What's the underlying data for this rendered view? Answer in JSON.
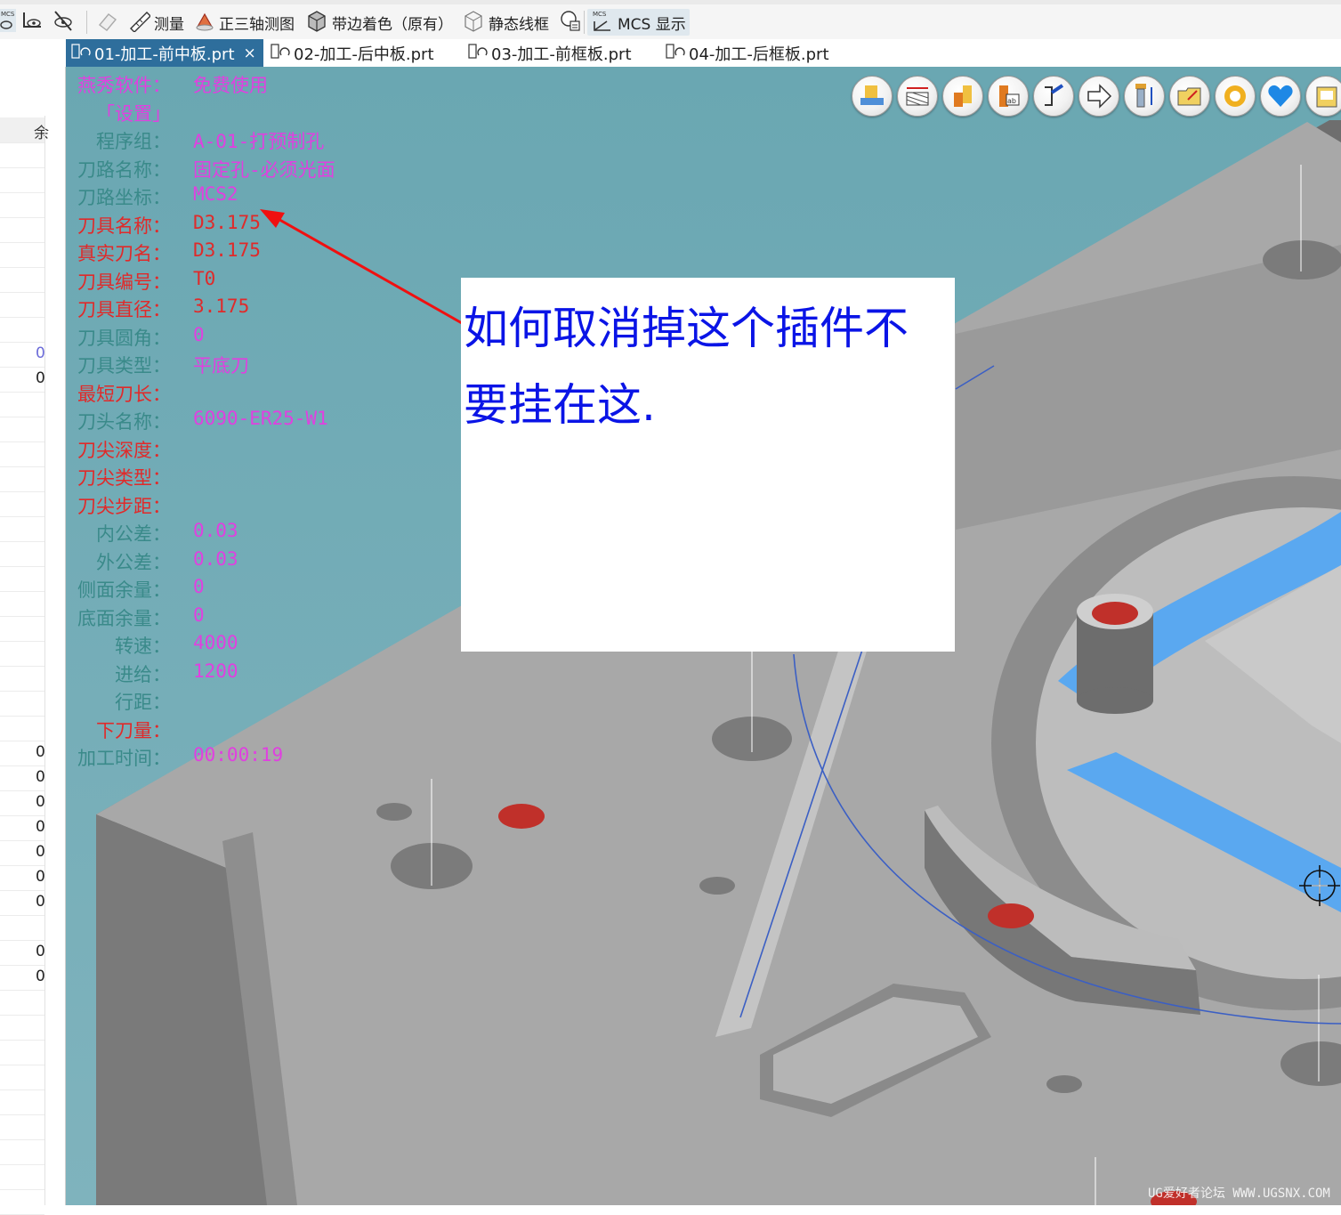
{
  "toolbar": {
    "items": [
      {
        "label": "",
        "icon": "mcs-view-icon"
      },
      {
        "label": "",
        "icon": "show-hide-icon"
      },
      {
        "label": "",
        "icon": "hide-all-icon"
      },
      {
        "label": "",
        "icon": "eraser-icon"
      },
      {
        "label": "测量",
        "icon": "ruler-icon"
      },
      {
        "label": "正三轴测图",
        "icon": "isometric-view-icon"
      },
      {
        "label": "带边着色（原有）",
        "icon": "shaded-edges-icon"
      },
      {
        "label": "静态线框",
        "icon": "wireframe-icon"
      },
      {
        "label": "",
        "icon": "layer-settings-icon"
      },
      {
        "label": "MCS 显示",
        "icon": "mcs-display-icon"
      }
    ]
  },
  "tabs": [
    {
      "label": "01-加工-前中板.prt",
      "active": true,
      "close": "×"
    },
    {
      "label": "02-加工-后中板.prt",
      "active": false
    },
    {
      "label": "03-加工-前框板.prt",
      "active": false
    },
    {
      "label": "04-加工-后框板.prt",
      "active": false
    }
  ],
  "left_panel": {
    "header": "余",
    "values": [
      "0",
      "0",
      "0",
      "0",
      "0",
      "0",
      "0",
      "0",
      "0",
      "0",
      "0"
    ]
  },
  "info_overlay": {
    "rows": [
      {
        "label": "燕秀软件：",
        "value": "免费使用",
        "label_color": "#e040e0",
        "value_color": "#e040e0"
      },
      {
        "label": "「设置」",
        "value": "",
        "label_color": "#e040e0",
        "value_color": "#e040e0"
      },
      {
        "label": "程序组：",
        "value": "A-01-打预制孔",
        "label_color": "#3a8a8a",
        "value_color": "#e040e0"
      },
      {
        "label": "刀路名称：",
        "value": "固定孔-必须光面",
        "label_color": "#3a8a8a",
        "value_color": "#e040e0"
      },
      {
        "label": "刀路坐标：",
        "value": "MCS2",
        "label_color": "#3a8a8a",
        "value_color": "#e040e0"
      },
      {
        "label": "刀具名称：",
        "value": "D3.175",
        "label_color": "#e02a2a",
        "value_color": "#e02a2a"
      },
      {
        "label": "真实刀名：",
        "value": "D3.175",
        "label_color": "#e02a2a",
        "value_color": "#e02a2a"
      },
      {
        "label": "刀具编号：",
        "value": "T0",
        "label_color": "#e02a2a",
        "value_color": "#e02a2a"
      },
      {
        "label": "刀具直径：",
        "value": "3.175",
        "label_color": "#e02a2a",
        "value_color": "#e02a2a"
      },
      {
        "label": "刀具圆角：",
        "value": "0",
        "label_color": "#3a8a8a",
        "value_color": "#e040e0"
      },
      {
        "label": "刀具类型：",
        "value": "平底刀",
        "label_color": "#3a8a8a",
        "value_color": "#e040e0"
      },
      {
        "label": "最短刀长：",
        "value": "",
        "label_color": "#e02a2a",
        "value_color": "#e02a2a"
      },
      {
        "label": "刀头名称：",
        "value": "6090-ER25-W1",
        "label_color": "#3a8a8a",
        "value_color": "#e040e0"
      },
      {
        "label": "刀尖深度：",
        "value": "",
        "label_color": "#e02a2a",
        "value_color": "#e02a2a"
      },
      {
        "label": "刀尖类型：",
        "value": "",
        "label_color": "#e02a2a",
        "value_color": "#e02a2a"
      },
      {
        "label": "刀尖步距：",
        "value": "",
        "label_color": "#e02a2a",
        "value_color": "#e02a2a"
      },
      {
        "label": "内公差：",
        "value": "0.03",
        "label_color": "#3a8a8a",
        "value_color": "#e040e0"
      },
      {
        "label": "外公差：",
        "value": "0.03",
        "label_color": "#3a8a8a",
        "value_color": "#e040e0"
      },
      {
        "label": "侧面余量：",
        "value": "0",
        "label_color": "#3a8a8a",
        "value_color": "#e040e0"
      },
      {
        "label": "底面余量：",
        "value": "0",
        "label_color": "#3a8a8a",
        "value_color": "#e040e0"
      },
      {
        "label": "转速：",
        "value": "4000",
        "label_color": "#3a8a8a",
        "value_color": "#e040e0"
      },
      {
        "label": "进给：",
        "value": "1200",
        "label_color": "#3a8a8a",
        "value_color": "#e040e0"
      },
      {
        "label": "行距：",
        "value": "",
        "label_color": "#3a8a8a",
        "value_color": "#e040e0"
      },
      {
        "label": "下刀量：",
        "value": "",
        "label_color": "#e02a2a",
        "value_color": "#e02a2a"
      },
      {
        "label": "加工时间：",
        "value": "00:00:19",
        "label_color": "#3a8a8a",
        "value_color": "#e040e0"
      }
    ]
  },
  "plugin_icons": [
    "fixture-icon",
    "stock-dimension-icon",
    "part-color-icon",
    "label-icon",
    "tool-list-icon",
    "arrow-right-icon",
    "drill-depth-icon",
    "folder-edit-icon",
    "gear-icon",
    "heart-icon",
    "export-doc-icon"
  ],
  "callout": {
    "text": "如何取消掉这个插件不要挂在这."
  },
  "watermark": "UG爱好者论坛 WWW.UGSNX.COM",
  "colors": {
    "viewport_bg": "#6fa9b4",
    "part_gray": "#a3a3a3",
    "highlight_blue": "#5aa8f0",
    "hole_red": "#c0302a",
    "tab_active": "#2e6e9c",
    "callout_text": "#0a14e6"
  }
}
